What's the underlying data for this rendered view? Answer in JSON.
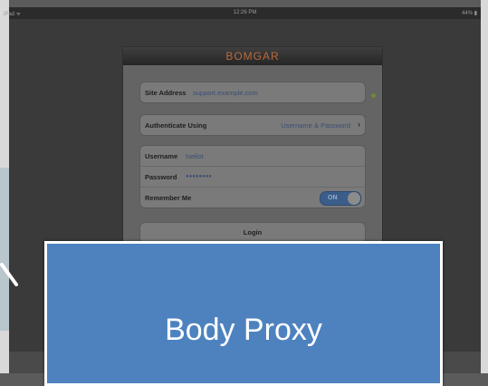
{
  "status_bar": {
    "carrier": "iPad ᯤ",
    "time": "12:26 PM",
    "battery": "44% ▮"
  },
  "app": {
    "brand": "BOMGAR"
  },
  "site": {
    "label": "Site Address",
    "value": "support.example.com"
  },
  "auth": {
    "label": "Authenticate Using",
    "value": "Username & Password"
  },
  "credentials": {
    "username_label": "Username",
    "username_value": "tseliot",
    "password_label": "Password",
    "password_value": "●●●●●●●●",
    "remember_label": "Remember Me",
    "remember_state": "ON"
  },
  "login_label": "Login",
  "overlay": {
    "label": "Body Proxy"
  }
}
